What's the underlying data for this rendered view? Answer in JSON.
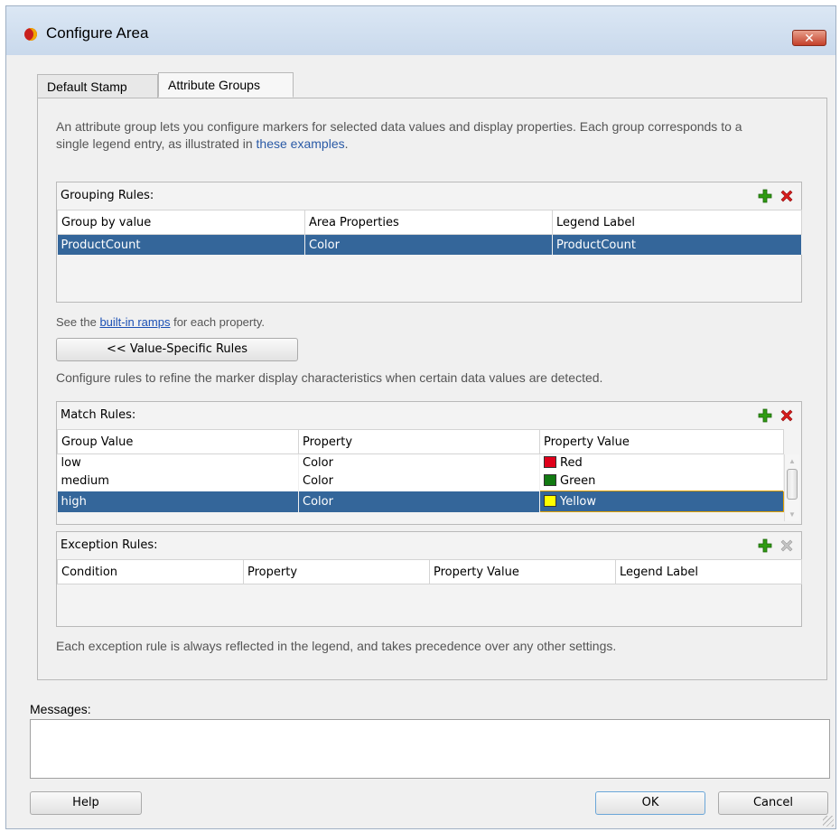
{
  "window": {
    "title": "Configure Area",
    "close_glyph": "✕"
  },
  "tabs": [
    {
      "label": "Default Stamp",
      "active": false
    },
    {
      "label": "Attribute Groups",
      "active": true
    }
  ],
  "intro": {
    "text": "An attribute group lets you configure markers for selected data values and display properties. Each group corresponds to a single legend entry, as illustrated in ",
    "link": "these examples",
    "suffix": "."
  },
  "grouping": {
    "title": "Grouping Rules:",
    "columns": [
      "Group by value",
      "Area Properties",
      "Legend Label"
    ],
    "rows": [
      [
        "ProductCount",
        "Color",
        "ProductCount"
      ]
    ]
  },
  "ramps": {
    "prefix": "See the ",
    "link": "built-in ramps",
    "suffix": " for each property."
  },
  "value_rules_button": "<< Value-Specific Rules",
  "value_rules_hint": "Configure rules to refine the marker display characteristics when certain data values are detected.",
  "match": {
    "title": "Match Rules:",
    "columns": [
      "Group Value",
      "Property",
      "Property Value"
    ],
    "rows": [
      {
        "group": "low",
        "property": "Color",
        "value": "Red",
        "swatch": "#e0001b"
      },
      {
        "group": "medium",
        "property": "Color",
        "value": "Green",
        "swatch": "#127a12"
      },
      {
        "group": "high",
        "property": "Color",
        "value": "Yellow",
        "swatch": "#ffff00"
      }
    ]
  },
  "exception": {
    "title": "Exception Rules:",
    "columns": [
      "Condition",
      "Property",
      "Property Value",
      "Legend Label"
    ]
  },
  "exception_note": "Each exception rule is always reflected in the legend, and takes precedence over any other settings.",
  "messages_label": "Messages:",
  "buttons": {
    "help": "Help",
    "ok": "OK",
    "cancel": "Cancel"
  },
  "colors": {
    "selection": "#34669a",
    "add_icon": "#2f9b12",
    "delete_icon": "#d81c1c"
  }
}
